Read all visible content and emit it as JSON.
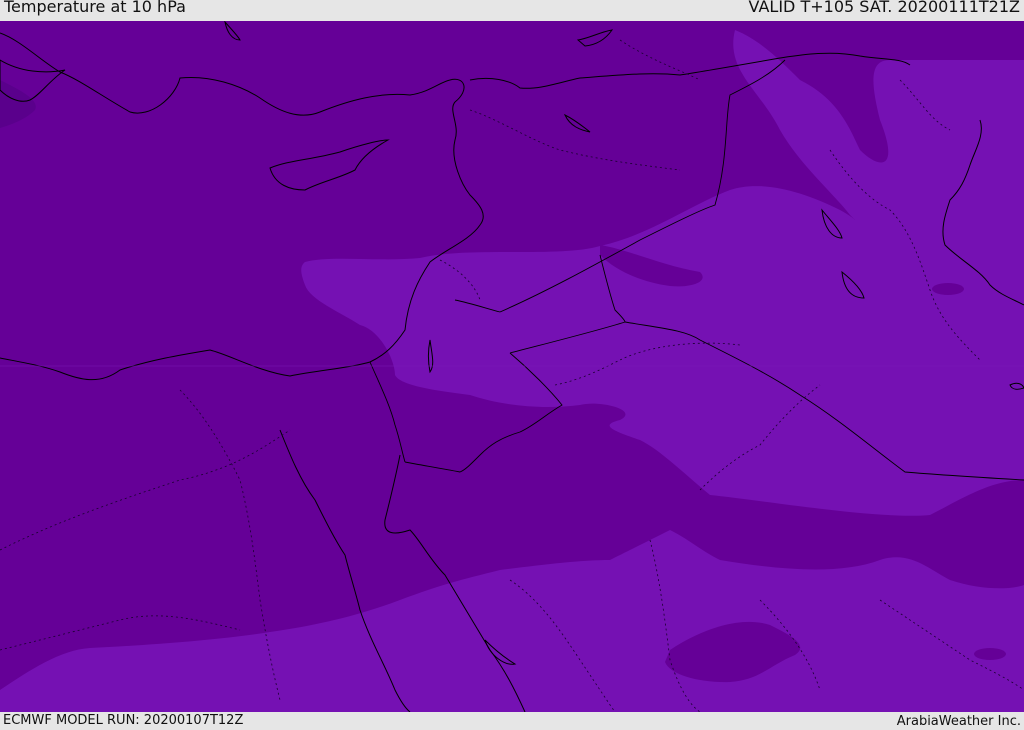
{
  "header": {
    "title": "Temperature at 10 hPa",
    "valid_time": "VALID T+105 SAT. 20200111T21Z"
  },
  "footer": {
    "model_run": "ECMWF MODEL RUN: 20200107T12Z",
    "credit": "ArabiaWeather Inc."
  },
  "map": {
    "parameter": "Temperature",
    "level": "10 hPa",
    "colors": {
      "dark_band": "#650097",
      "light_band": "#7511b3",
      "darkest_spot": "#5a008c",
      "coastline": "#000000",
      "border": "#000000"
    }
  }
}
